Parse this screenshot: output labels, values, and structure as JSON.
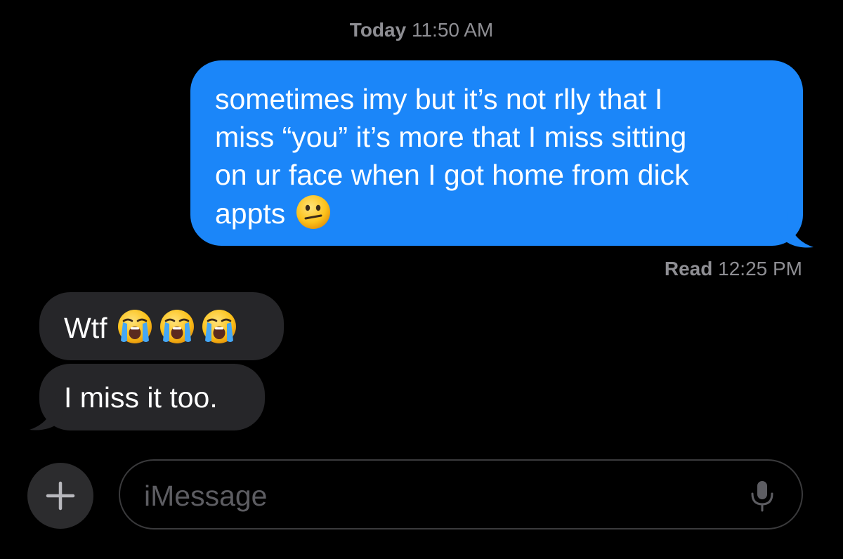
{
  "header": {
    "timestamp_day": "Today",
    "timestamp_time": "11:50 AM"
  },
  "messages": {
    "sent": {
      "lines": [
        "sometimes imy but it’s not rlly that I",
        "miss “you” it’s more that I miss sitting",
        "on ur face when I got home from dick",
        "appts"
      ],
      "emoji": "confused-face-emoji",
      "color": "#1b86f9"
    },
    "read_receipt": {
      "label": "Read",
      "time": "12:25 PM"
    },
    "received": [
      {
        "text": "Wtf",
        "emoji": [
          "loudly-crying-face-emoji",
          "loudly-crying-face-emoji",
          "loudly-crying-face-emoji"
        ]
      },
      {
        "text": "I miss it too."
      }
    ],
    "received_color": "#262629"
  },
  "composer": {
    "plus_icon": "plus-icon",
    "placeholder": "iMessage",
    "mic_icon": "microphone-icon"
  }
}
